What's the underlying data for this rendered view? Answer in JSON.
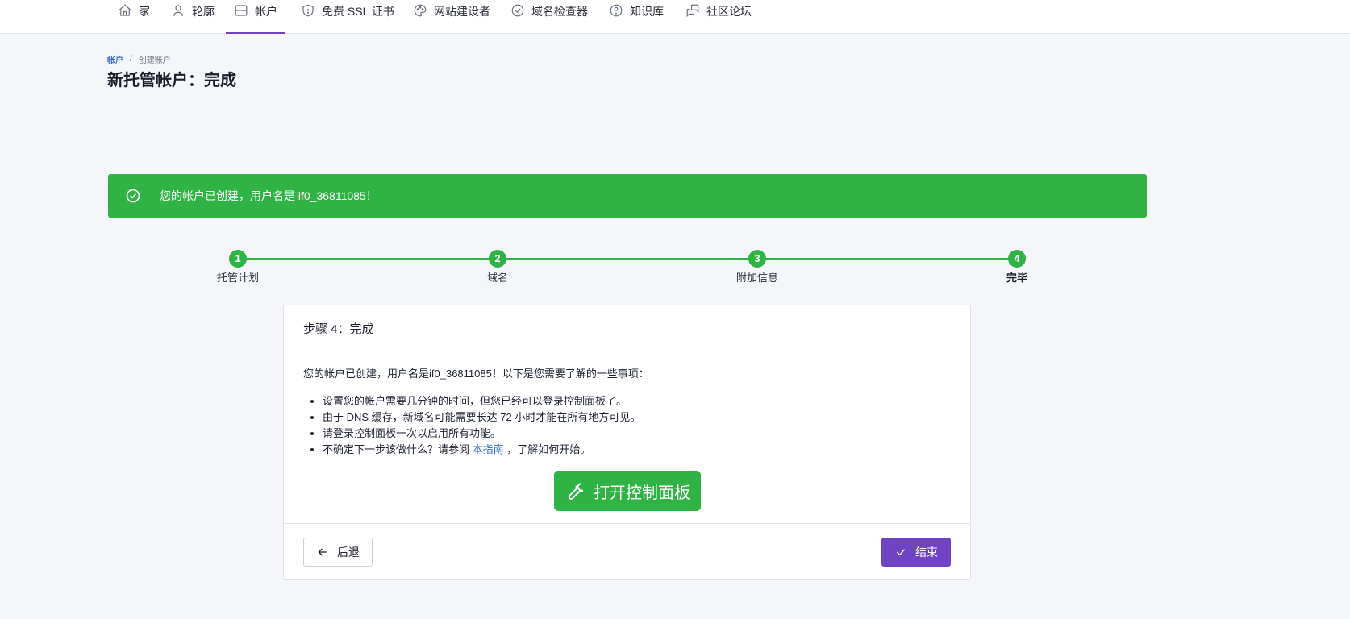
{
  "nav": {
    "items": [
      {
        "label": "家",
        "icon": "home-icon"
      },
      {
        "label": "轮廓",
        "icon": "user-icon"
      },
      {
        "label": "帐户",
        "icon": "server-icon",
        "active": true
      },
      {
        "label": "免费 SSL 证书",
        "icon": "shield-icon"
      },
      {
        "label": "网站建设者",
        "icon": "palette-icon"
      },
      {
        "label": "域名检查器",
        "icon": "check-circle-icon"
      },
      {
        "label": "知识库",
        "icon": "help-circle-icon"
      },
      {
        "label": "社区论坛",
        "icon": "messages-icon"
      }
    ],
    "accent_color": "#6f42c1"
  },
  "breadcrumb": {
    "link": "帐户",
    "separator": "/",
    "current": "创建账户"
  },
  "page_title": "新托管帐户：完成",
  "alert": {
    "message": "您的帐户已创建，用户名是 if0_36811085！",
    "color": "#2fb344"
  },
  "stepper": {
    "steps": [
      {
        "number": "1",
        "label": "托管计划"
      },
      {
        "number": "2",
        "label": "域名"
      },
      {
        "number": "3",
        "label": "附加信息"
      },
      {
        "number": "4",
        "label": "完毕",
        "current": true
      }
    ]
  },
  "card": {
    "header": "步骤 4：完成",
    "intro": "您的帐户已创建，用户名是if0_36811085！以下是您需要了解的一些事项：",
    "bullets": [
      "设置您的帐户需要几分钟的时间，但您已经可以登录控制面板了。",
      "由于 DNS 缓存，新域名可能需要长达 72 小时才能在所有地方可见。",
      "请登录控制面板一次以启用所有功能。"
    ],
    "last_bullet_prefix": "不确定下一步该做什么？请参阅",
    "last_bullet_link": "本指南",
    "last_bullet_suffix": "，了解如何开始。",
    "open_panel_label": "打开控制面板",
    "back_label": "后退",
    "finish_label": "结束"
  }
}
